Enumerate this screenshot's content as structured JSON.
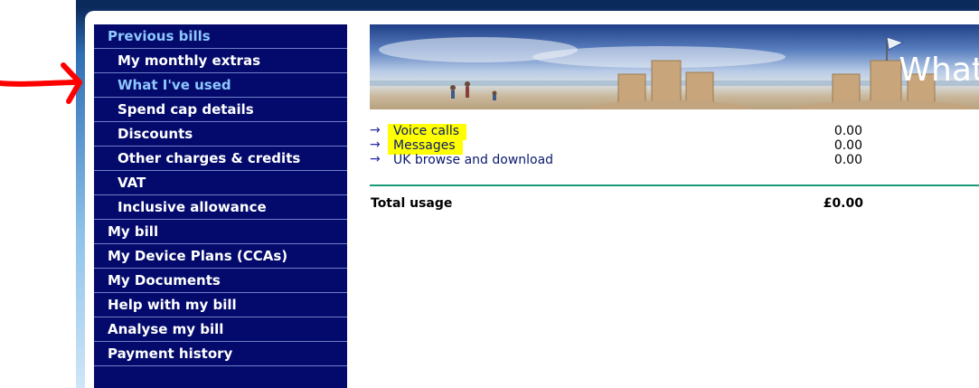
{
  "sidebar": {
    "items": [
      {
        "label": "Previous bills",
        "level": "top",
        "accent": true
      },
      {
        "label": "My monthly extras",
        "level": "sub",
        "accent": false
      },
      {
        "label": "What I've used",
        "level": "sub",
        "accent": true,
        "annotated": true
      },
      {
        "label": "Spend cap details",
        "level": "sub",
        "accent": false
      },
      {
        "label": "Discounts",
        "level": "sub",
        "accent": false
      },
      {
        "label": "Other charges & credits",
        "level": "sub",
        "accent": false
      },
      {
        "label": "VAT",
        "level": "sub",
        "accent": false
      },
      {
        "label": "Inclusive allowance",
        "level": "sub",
        "accent": false
      },
      {
        "label": "My bill",
        "level": "top",
        "accent": false
      },
      {
        "label": "My Device Plans (CCAs)",
        "level": "top",
        "accent": false
      },
      {
        "label": "My Documents",
        "level": "top",
        "accent": false
      },
      {
        "label": "Help with my bill",
        "level": "top",
        "accent": false
      },
      {
        "label": "Analyse my bill",
        "level": "top",
        "accent": false
      },
      {
        "label": "Payment history",
        "level": "top",
        "accent": false
      }
    ]
  },
  "banner": {
    "title": "What"
  },
  "usage": {
    "rows": [
      {
        "label": "Voice calls",
        "value": "0.00",
        "highlighted": true,
        "icon": "arrow-right-icon"
      },
      {
        "label": "Messages",
        "value": "0.00",
        "highlighted": true,
        "icon": "arrow-right-icon"
      },
      {
        "label": "UK browse and download",
        "value": "0.00",
        "highlighted": false,
        "icon": "arrow-right-icon"
      }
    ],
    "total_label": "Total usage",
    "total_value": "£0.00"
  },
  "colors": {
    "sidebar_bg": "#030a6b",
    "sidebar_accent": "#8ec7ff",
    "highlight": "#ffff00",
    "divider": "#1a9a7a",
    "annotation": "#ff0000"
  }
}
